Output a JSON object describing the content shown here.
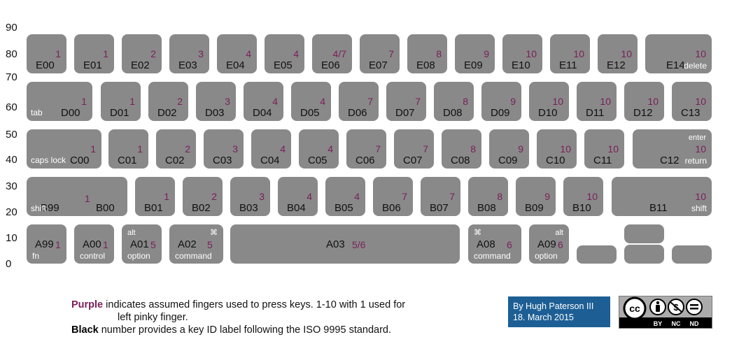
{
  "y_axis": {
    "ticks": [
      "90",
      "80",
      "70",
      "60",
      "50",
      "40",
      "30",
      "20",
      "10",
      "0"
    ]
  },
  "keys": [
    {
      "id": "E00",
      "finger": "1",
      "label": ""
    },
    {
      "id": "E01",
      "finger": "1",
      "label": ""
    },
    {
      "id": "E02",
      "finger": "2",
      "label": ""
    },
    {
      "id": "E03",
      "finger": "3",
      "label": ""
    },
    {
      "id": "E04",
      "finger": "4",
      "label": ""
    },
    {
      "id": "E05",
      "finger": "4",
      "label": ""
    },
    {
      "id": "E06",
      "finger": "4/7",
      "label": ""
    },
    {
      "id": "E07",
      "finger": "7",
      "label": ""
    },
    {
      "id": "E08",
      "finger": "8",
      "label": ""
    },
    {
      "id": "E09",
      "finger": "9",
      "label": ""
    },
    {
      "id": "E10",
      "finger": "10",
      "label": ""
    },
    {
      "id": "E11",
      "finger": "10",
      "label": ""
    },
    {
      "id": "E12",
      "finger": "10",
      "label": ""
    },
    {
      "id": "E14",
      "finger": "10",
      "label": "delete"
    },
    {
      "id": "D00",
      "finger": "1",
      "label": "tab"
    },
    {
      "id": "D01",
      "finger": "1",
      "label": ""
    },
    {
      "id": "D02",
      "finger": "2",
      "label": ""
    },
    {
      "id": "D03",
      "finger": "3",
      "label": ""
    },
    {
      "id": "D04",
      "finger": "4",
      "label": ""
    },
    {
      "id": "D05",
      "finger": "4",
      "label": ""
    },
    {
      "id": "D06",
      "finger": "7",
      "label": ""
    },
    {
      "id": "D07",
      "finger": "7",
      "label": ""
    },
    {
      "id": "D08",
      "finger": "8",
      "label": ""
    },
    {
      "id": "D09",
      "finger": "9",
      "label": ""
    },
    {
      "id": "D10",
      "finger": "10",
      "label": ""
    },
    {
      "id": "D11",
      "finger": "10",
      "label": ""
    },
    {
      "id": "D12",
      "finger": "10",
      "label": ""
    },
    {
      "id": "C13",
      "finger": "10",
      "label": ""
    },
    {
      "id": "C00",
      "finger": "1",
      "label": "caps lock"
    },
    {
      "id": "C01",
      "finger": "1",
      "label": ""
    },
    {
      "id": "C02",
      "finger": "2",
      "label": ""
    },
    {
      "id": "C03",
      "finger": "3",
      "label": ""
    },
    {
      "id": "C04",
      "finger": "4",
      "label": ""
    },
    {
      "id": "C05",
      "finger": "4",
      "label": ""
    },
    {
      "id": "C06",
      "finger": "7",
      "label": ""
    },
    {
      "id": "C07",
      "finger": "7",
      "label": ""
    },
    {
      "id": "C08",
      "finger": "8",
      "label": ""
    },
    {
      "id": "C09",
      "finger": "9",
      "label": ""
    },
    {
      "id": "C10",
      "finger": "10",
      "label": ""
    },
    {
      "id": "C11",
      "finger": "10",
      "label": ""
    },
    {
      "id": "C12",
      "finger": "10",
      "label": "return",
      "label_top": "enter"
    },
    {
      "id": "B99",
      "id2": "B00",
      "finger": "1",
      "label": "shift"
    },
    {
      "id": "B01",
      "finger": "1",
      "label": ""
    },
    {
      "id": "B02",
      "finger": "2",
      "label": ""
    },
    {
      "id": "B03",
      "finger": "3",
      "label": ""
    },
    {
      "id": "B04",
      "finger": "4",
      "label": ""
    },
    {
      "id": "B05",
      "finger": "4",
      "label": ""
    },
    {
      "id": "B06",
      "finger": "7",
      "label": ""
    },
    {
      "id": "B07",
      "finger": "7",
      "label": ""
    },
    {
      "id": "B08",
      "finger": "8",
      "label": ""
    },
    {
      "id": "B09",
      "finger": "9",
      "label": ""
    },
    {
      "id": "B10",
      "finger": "10",
      "label": ""
    },
    {
      "id": "B11",
      "finger": "10",
      "label": "shift"
    },
    {
      "id": "A99",
      "finger": "1",
      "label": "fn"
    },
    {
      "id": "A00",
      "finger": "1",
      "label": "control"
    },
    {
      "id": "A01",
      "finger": "5",
      "label": "option",
      "label_top": "alt"
    },
    {
      "id": "A02",
      "finger": "5",
      "label": "command",
      "label_top": "⌘"
    },
    {
      "id": "A03",
      "finger": "5/6",
      "label": ""
    },
    {
      "id": "A08",
      "finger": "6",
      "label": "command",
      "label_top": "⌘"
    },
    {
      "id": "A09",
      "finger": "6",
      "label": "option",
      "label_top": "alt"
    },
    {
      "id": "",
      "finger": "",
      "label": ""
    },
    {
      "id": "",
      "finger": "",
      "label": ""
    },
    {
      "id": "",
      "finger": "",
      "label": ""
    },
    {
      "id": "",
      "finger": "",
      "label": ""
    }
  ],
  "legend": {
    "purple_word": "Purple",
    "purple_text": " indicates assumed fingers used to press keys. 1-10 with 1 used for",
    "purple_text_cont": "left pinky finger.",
    "black_word": "Black",
    "black_text": " number provides a key ID label following the ISO 9995 standard."
  },
  "author": {
    "line1": "By Hugh Paterson III",
    "line2": "18. March 2015"
  },
  "license": {
    "badge": "cc",
    "terms": [
      "BY",
      "NC",
      "ND"
    ]
  },
  "colors": {
    "key": "#898989",
    "finger": "#7a1f5a",
    "author_box": "#1d5f95"
  }
}
